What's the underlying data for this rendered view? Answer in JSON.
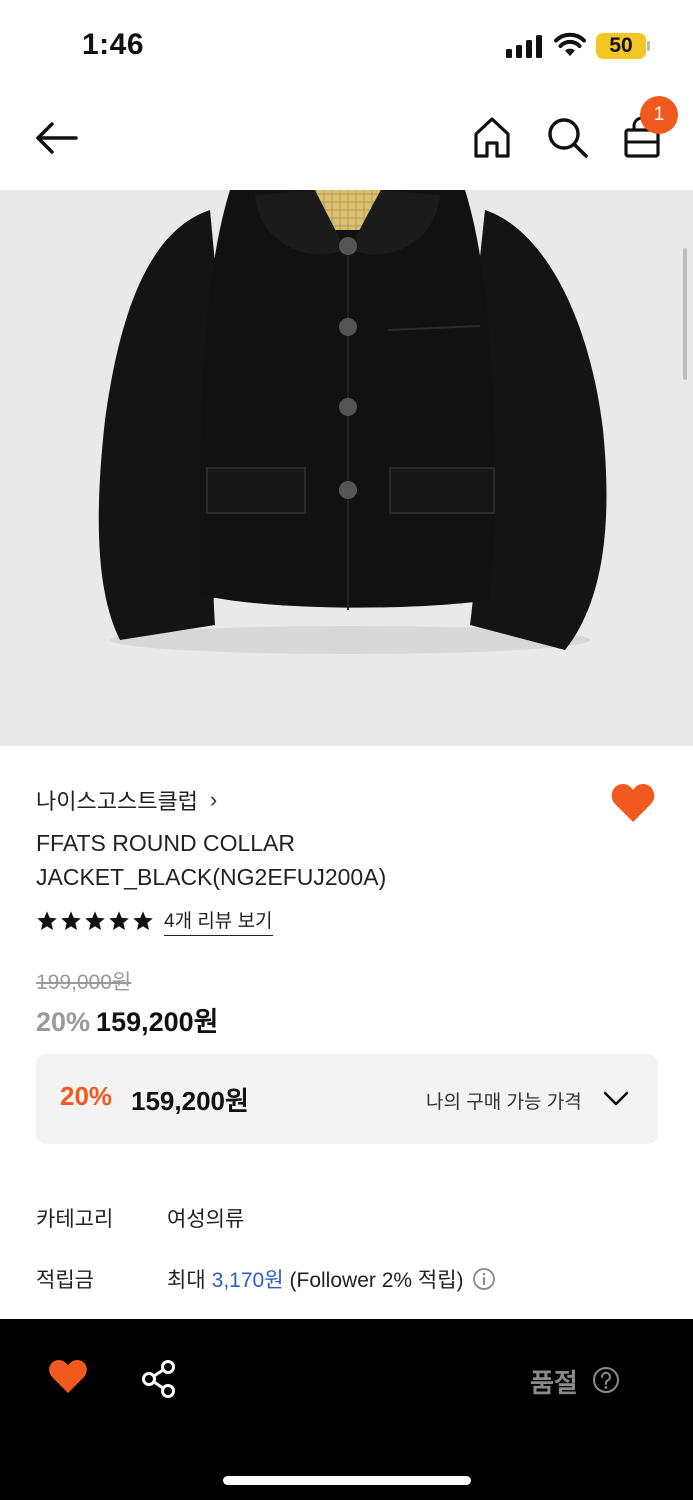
{
  "status_bar": {
    "time": "1:46",
    "battery": "50",
    "battery_color": "#f3c623"
  },
  "nav": {
    "back_icon": "arrow-left-icon",
    "home_icon": "home-icon",
    "search_icon": "search-icon",
    "cart_icon": "shopping-bag-icon",
    "cart_badge": "1",
    "badge_color": "#f05a1e"
  },
  "product": {
    "image_alt_icon": "black-jacket-image",
    "brand": "나이스고스트클럽",
    "brand_chevron": "›",
    "name": "FFATS ROUND COLLAR JACKET_BLACK(NG2EFUJ200A)",
    "rating": 5,
    "review_link": "4개 리뷰 보기",
    "original_price": "199,000원",
    "discount": "20%",
    "price": "159,200원",
    "wish_color": "#f05a1e"
  },
  "my_price": {
    "discount": "20%",
    "price": "159,200원",
    "label": "나의 구매 가능 가격"
  },
  "details": {
    "category_label": "카테고리",
    "category_value": "여성의류",
    "points_label": "적립금",
    "points_prefix": "최대",
    "points_amount": "3,170원",
    "points_suffix": "(Follower 2% 적립)"
  },
  "bottom_bar": {
    "heart_icon": "heart-icon",
    "share_icon": "share-icon",
    "soldout_label": "품절",
    "help_icon": "question-circle-icon"
  }
}
